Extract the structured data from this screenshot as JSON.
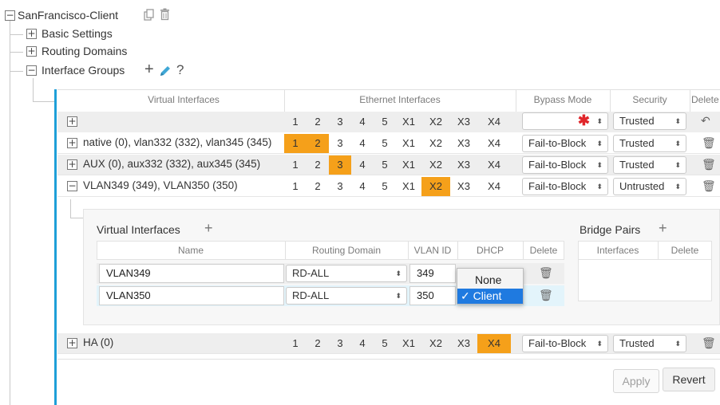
{
  "tree": {
    "root_label": "SanFrancisco-Client",
    "items": [
      {
        "label": "Basic Settings"
      },
      {
        "label": "Routing Domains"
      },
      {
        "label": "Interface Groups"
      }
    ],
    "help_text": "?"
  },
  "main_table": {
    "headers": {
      "virtual": "Virtual Interfaces",
      "ethernet": "Ethernet Interfaces",
      "bypass": "Bypass Mode",
      "security": "Security",
      "delete": "Delete"
    },
    "ports": [
      "1",
      "2",
      "3",
      "4",
      "5",
      "X1",
      "X2",
      "X3",
      "X4"
    ],
    "new_row": {
      "highlight": [],
      "security": "Trusted"
    },
    "rows": [
      {
        "label": "native (0), vlan332 (332), vlan345 (345)",
        "highlight": [
          0,
          1
        ],
        "bypass": "Fail-to-Block",
        "security": "Trusted"
      },
      {
        "label": "AUX (0), aux332 (332), aux345 (345)",
        "highlight": [
          2
        ],
        "bypass": "Fail-to-Block",
        "security": "Trusted"
      },
      {
        "label": "VLAN349 (349), VLAN350 (350)",
        "highlight": [
          6
        ],
        "bypass": "Fail-to-Block",
        "security": "Untrusted"
      }
    ],
    "ha_row": {
      "label": "HA (0)",
      "highlight": [
        8
      ],
      "bypass": "Fail-to-Block",
      "security": "Trusted"
    }
  },
  "detail": {
    "vi_title": "Virtual Interfaces",
    "bp_title": "Bridge Pairs",
    "vi_headers": {
      "name": "Name",
      "routing_domain": "Routing Domain",
      "vlan_id": "VLAN ID",
      "dhcp": "DHCP",
      "delete": "Delete"
    },
    "bp_headers": {
      "interfaces": "Interfaces",
      "delete": "Delete"
    },
    "vi_rows": [
      {
        "name": "VLAN349",
        "routing_domain": "RD-ALL",
        "vlan_id": "349"
      },
      {
        "name": "VLAN350",
        "routing_domain": "RD-ALL",
        "vlan_id": "350"
      }
    ],
    "dhcp_dropdown": {
      "options": [
        "None",
        "Client"
      ],
      "selected_index": 1
    }
  },
  "buttons": {
    "apply": "Apply",
    "revert": "Revert"
  },
  "colors": {
    "accent": "#1e9fd8",
    "highlight": "#f5a01a",
    "required": "#e0262b",
    "selected": "#1f7ae0"
  }
}
